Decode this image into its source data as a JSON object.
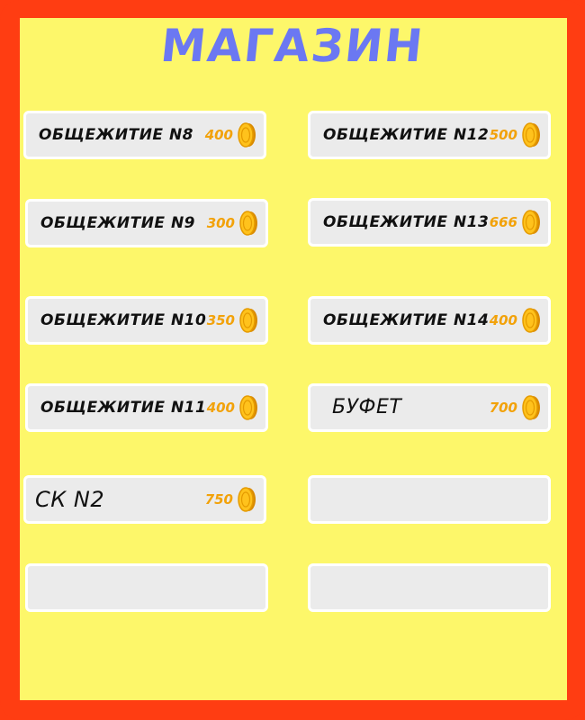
{
  "title": "МАГАЗИН",
  "colors": {
    "frame": "#ff3d12",
    "panel": "#fdf76a",
    "title": "#6b78f2",
    "price": "#f2a20a",
    "slot": "#ebebeb"
  },
  "slots": [
    {
      "label": "ОБЩЕЖИТИЕ N8",
      "price": "400",
      "icon": "coin-icon"
    },
    {
      "label": "ОБЩЕЖИТИЕ N12",
      "price": "500",
      "icon": "coin-icon"
    },
    {
      "label": "ОБЩЕЖИТИЕ N9",
      "price": "300",
      "icon": "coin-icon"
    },
    {
      "label": "ОБЩЕЖИТИЕ N13",
      "price": "666",
      "icon": "coin-icon"
    },
    {
      "label": "ОБЩЕЖИТИЕ N10",
      "price": "350",
      "icon": "coin-icon"
    },
    {
      "label": "ОБЩЕЖИТИЕ N14",
      "price": "400",
      "icon": "coin-icon"
    },
    {
      "label": "ОБЩЕЖИТИЕ N11",
      "price": "400",
      "icon": "coin-icon"
    },
    {
      "label": "БУФЕТ",
      "price": "700",
      "icon": "coin-icon"
    },
    {
      "label": "СК N2",
      "price": "750",
      "icon": "coin-icon"
    },
    {
      "label": "",
      "price": ""
    },
    {
      "label": "",
      "price": ""
    },
    {
      "label": "",
      "price": ""
    }
  ]
}
